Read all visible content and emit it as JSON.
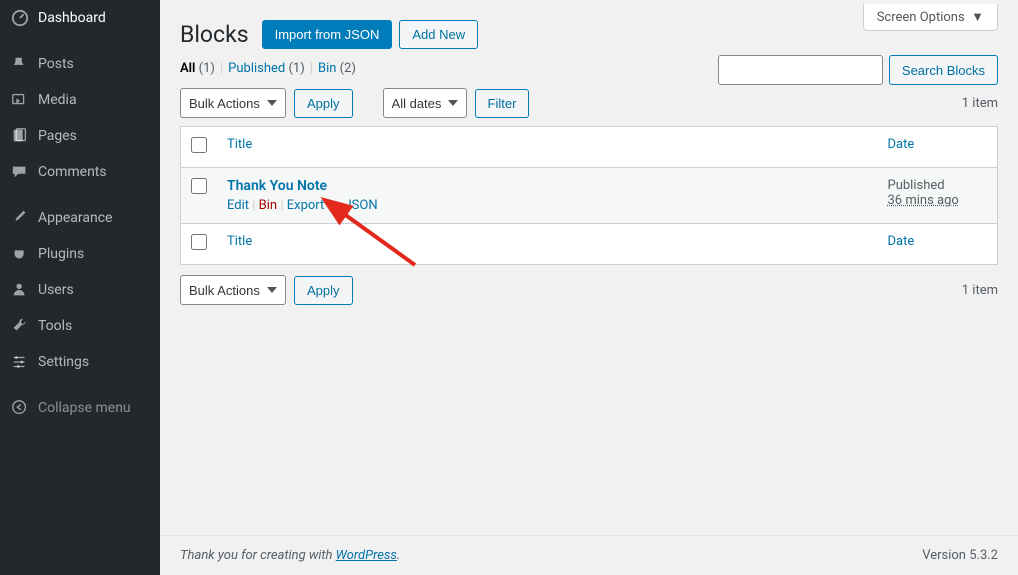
{
  "sidebar": {
    "items": [
      {
        "label": "Dashboard",
        "icon": "dashboard"
      },
      {
        "label": "Posts",
        "icon": "pin"
      },
      {
        "label": "Media",
        "icon": "media"
      },
      {
        "label": "Pages",
        "icon": "page"
      },
      {
        "label": "Comments",
        "icon": "comment"
      },
      {
        "label": "Appearance",
        "icon": "brush"
      },
      {
        "label": "Plugins",
        "icon": "plug"
      },
      {
        "label": "Users",
        "icon": "user"
      },
      {
        "label": "Tools",
        "icon": "wrench"
      },
      {
        "label": "Settings",
        "icon": "sliders"
      },
      {
        "label": "Collapse menu",
        "icon": "collapse"
      }
    ]
  },
  "screen_options_label": "Screen Options",
  "header": {
    "title": "Blocks",
    "import_btn": "Import from JSON",
    "add_new_btn": "Add New"
  },
  "subsub": {
    "all_label": "All",
    "all_count": "(1)",
    "published_label": "Published",
    "published_count": "(1)",
    "bin_label": "Bin",
    "bin_count": "(2)"
  },
  "search": {
    "placeholder": "",
    "button": "Search Blocks"
  },
  "filters": {
    "bulk_actions": "Bulk Actions",
    "apply": "Apply",
    "all_dates": "All dates",
    "filter": "Filter",
    "items_count": "1 item"
  },
  "columns": {
    "title": "Title",
    "date": "Date"
  },
  "rows": [
    {
      "title": "Thank You Note",
      "actions": {
        "edit": "Edit",
        "bin": "Bin",
        "export": "Export as JSON"
      },
      "status": "Published",
      "time": "36 mins ago"
    }
  ],
  "footer": {
    "thank_prefix": "Thank you for creating with ",
    "wp_link": "WordPress",
    "thank_suffix": ".",
    "version_prefix": "Version ",
    "version": "5.3.2"
  }
}
